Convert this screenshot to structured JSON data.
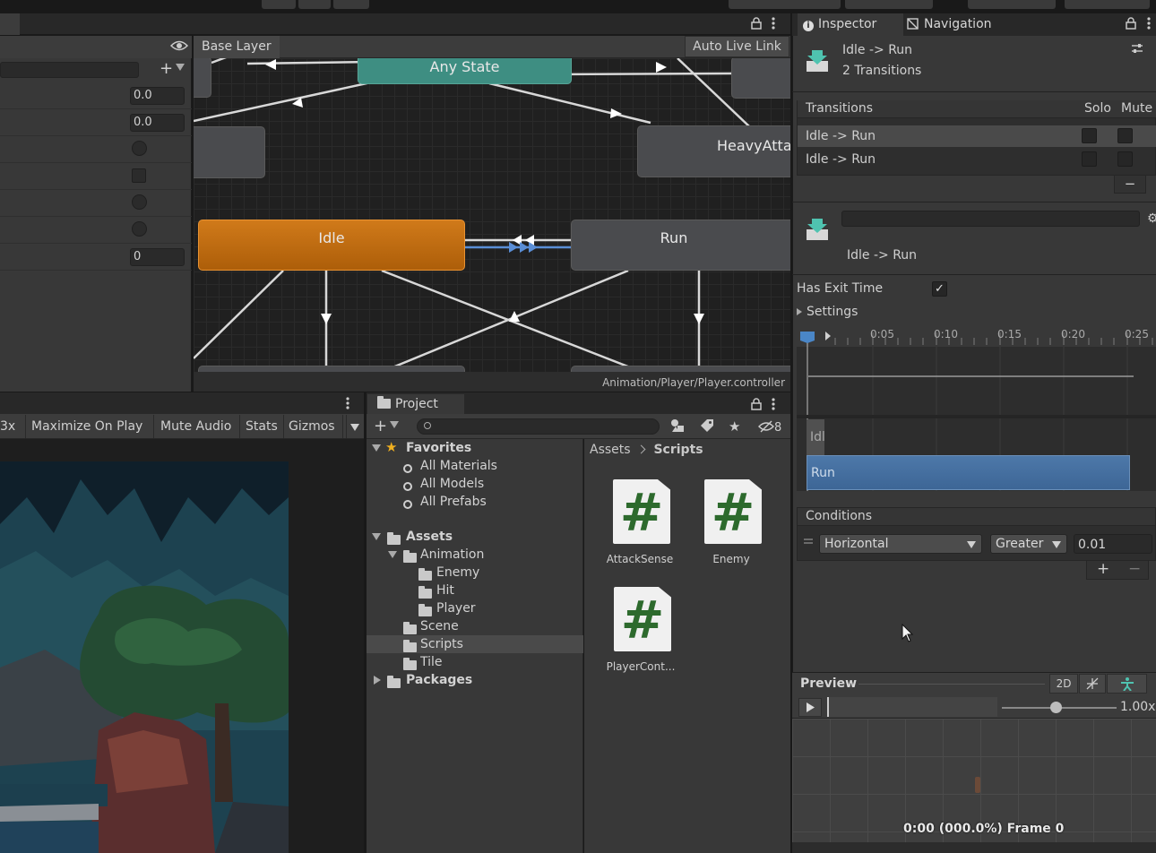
{
  "animator": {
    "base_layer": "Base Layer",
    "auto_live_link": "Auto Live Link",
    "path": "Animation/Player/Player.controller",
    "params": {
      "float1": "0.0",
      "float2": "0.0",
      "int1": "0"
    },
    "states": {
      "any": "Any State",
      "heavy": "HeavyAtta",
      "idle": "Idle",
      "run": "Run"
    }
  },
  "inspector": {
    "tabs": [
      "Inspector",
      "Navigation"
    ],
    "title": "Idle -> Run",
    "subtitle": "2 Transitions",
    "transitions_header": "Transitions",
    "solo": "Solo",
    "mute": "Mute",
    "rows": [
      "Idle -> Run",
      "Idle -> Run"
    ],
    "minus": "−",
    "transition_name": "Idle -> Run",
    "has_exit_time": "Has Exit Time",
    "settings": "Settings",
    "timeline_ticks": [
      "0:05",
      "0:10",
      "0:15",
      "0:20",
      "0:25"
    ],
    "idle_label": "Idl",
    "run_label": "Run",
    "conditions": "Conditions",
    "condition": {
      "param": "Horizontal",
      "op": "Greater",
      "value": "0.01"
    },
    "plus": "+",
    "preview": {
      "label": "Preview",
      "mode2d": "2D",
      "speed": "1.00x",
      "status": "0:00 (000.0%) Frame 0"
    }
  },
  "game": {
    "toolbar": [
      "3x",
      "Maximize On Play",
      "Mute Audio",
      "Stats",
      "Gizmos"
    ]
  },
  "project": {
    "tab": "Project",
    "hidden_count": "8",
    "favorites": "Favorites",
    "fav_items": [
      "All Materials",
      "All Models",
      "All Prefabs"
    ],
    "assets": "Assets",
    "animation": "Animation",
    "anim_children": [
      "Enemy",
      "Hit",
      "Player"
    ],
    "folders": [
      "Scene",
      "Scripts",
      "Tile"
    ],
    "packages": "Packages",
    "crumb_root": "Assets",
    "crumb_current": "Scripts",
    "scripts": [
      "AttackSense",
      "Enemy",
      "PlayerCont..."
    ],
    "hash": "#"
  },
  "colors": {
    "idle_state": "#c86f12",
    "any_state": "#3e8e82",
    "run_bar": "#4670a0"
  }
}
